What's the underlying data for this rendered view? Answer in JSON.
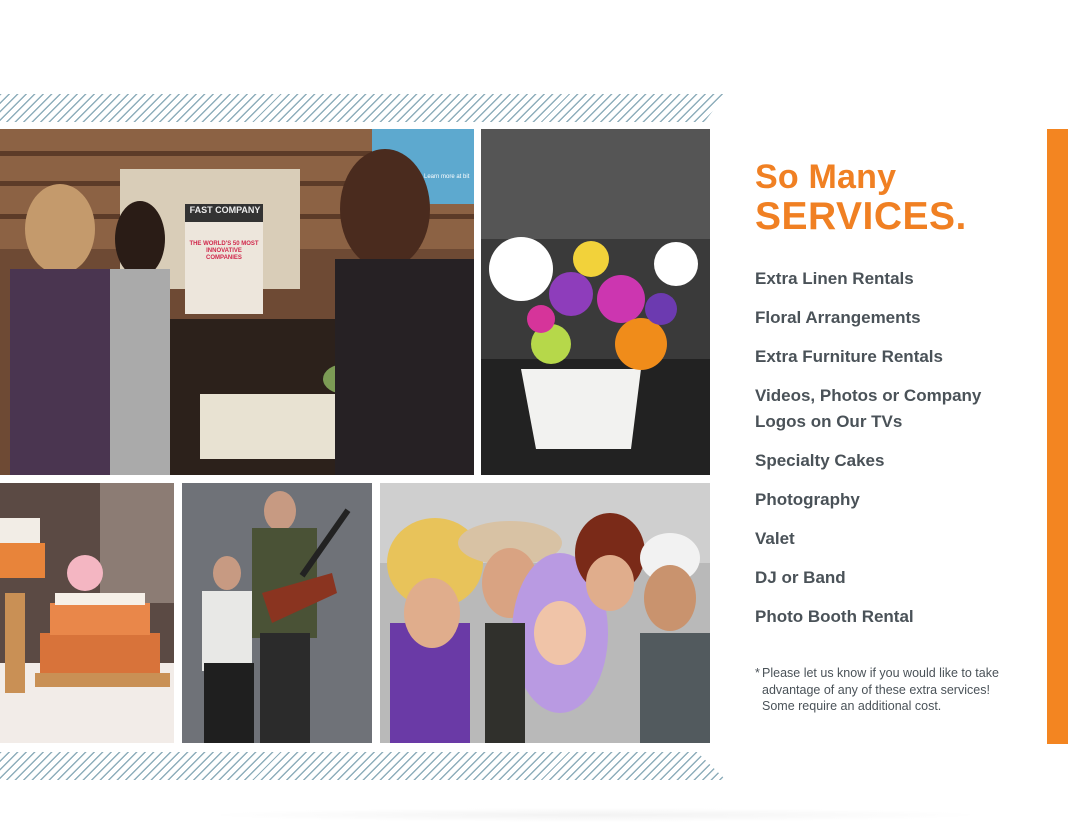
{
  "heading": {
    "line1": "So Many",
    "line2": "SERVICES."
  },
  "services": [
    "Extra Linen Rentals",
    "Floral Arrangements",
    "Extra Furniture Rentals",
    "Videos, Photos or Company Logos on Our TVs",
    "Specialty Cakes",
    "Photography",
    "Valet",
    "DJ or Band",
    "Photo Booth Rental"
  ],
  "note": {
    "star": "*",
    "text": "Please let us know if you would like to take advantage of any of these extra services! Some require an additional cost."
  },
  "photos": {
    "magazine_cover_text": "FAST COMPANY",
    "magazine_cover_sub": "THE WORLD'S 50 MOST INNOVATIVE COMPANIES",
    "tv_screen_text": "Learn more at bit"
  },
  "colors": {
    "accent_orange": "#f08023",
    "bar_orange": "#f38521",
    "body_text": "#4a5258",
    "stripe_blue": "#8eaebb"
  }
}
